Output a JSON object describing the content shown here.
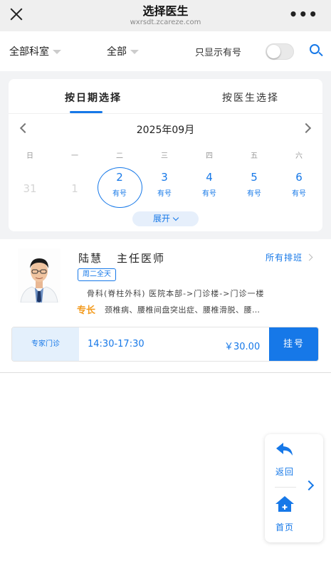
{
  "header": {
    "title": "选择医生",
    "url": "wxrsdt.zcareze.com",
    "close_icon": "close-icon",
    "more_icon": "more-icon"
  },
  "filters": {
    "department": "全部科室",
    "category": "全部",
    "only_available_label": "只显示有号",
    "only_available": false,
    "search_icon": "search-icon"
  },
  "tabs": [
    {
      "label": "按日期选择",
      "active": true
    },
    {
      "label": "按医生选择",
      "active": false
    }
  ],
  "calendar": {
    "month_label": "2025年09月",
    "weekdays": [
      "日",
      "一",
      "二",
      "三",
      "四",
      "五",
      "六"
    ],
    "days": [
      {
        "num": "31",
        "status": ""
      },
      {
        "num": "1",
        "status": ""
      },
      {
        "num": "2",
        "status": "有号"
      },
      {
        "num": "3",
        "status": "有号"
      },
      {
        "num": "4",
        "status": "有号"
      },
      {
        "num": "5",
        "status": "有号"
      },
      {
        "num": "6",
        "status": "有号"
      }
    ],
    "selected_day": "2",
    "expand_label": "展开"
  },
  "doctor": {
    "name": "陆慧",
    "title": "主任医师",
    "all_schedules_label": "所有排班",
    "schedule_badge": "周二全天",
    "department_location": "骨科(脊柱外科)   医院本部->门诊楼->门诊一楼",
    "specialty_label": "专长",
    "specialty_text": "颈椎病、腰椎间盘突出症、腰椎滑脱、腰…"
  },
  "slot": {
    "type": "专家门诊",
    "time": "14:30-17:30",
    "price": "￥30.00",
    "register_label": "挂号"
  },
  "float_nav": {
    "back_label": "返回",
    "home_label": "首页",
    "back_icon": "back-arrow-icon",
    "home_icon": "home-icon"
  },
  "colors": {
    "accent": "#1678e8",
    "specialty": "#f39b1e",
    "header_bg": "#efefef",
    "page_bg": "#f2f3f5"
  }
}
